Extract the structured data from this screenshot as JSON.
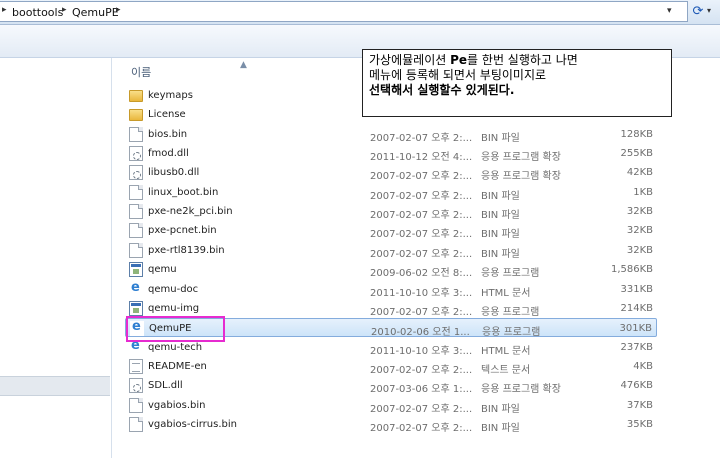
{
  "address_bar": {
    "breadcrumbs": [
      "boottools",
      "QemuPE"
    ]
  },
  "columns": {
    "name": "이름"
  },
  "files": [
    {
      "name": "keymaps",
      "date": "",
      "type": "",
      "size": "",
      "icon": "folder-icon"
    },
    {
      "name": "License",
      "date": "",
      "type": "",
      "size": "",
      "icon": "folder-icon"
    },
    {
      "name": "bios.bin",
      "date": "2007-02-07 오후 2:...",
      "type": "BIN 파일",
      "size": "128KB",
      "icon": "file-icon"
    },
    {
      "name": "fmod.dll",
      "date": "2011-10-12 오전 4:...",
      "type": "응용 프로그램 확장",
      "size": "255KB",
      "icon": "dll-icon"
    },
    {
      "name": "libusb0.dll",
      "date": "2007-02-07 오후 2:...",
      "type": "응용 프로그램 확장",
      "size": "42KB",
      "icon": "dll-icon"
    },
    {
      "name": "linux_boot.bin",
      "date": "2007-02-07 오후 2:...",
      "type": "BIN 파일",
      "size": "1KB",
      "icon": "file-icon"
    },
    {
      "name": "pxe-ne2k_pci.bin",
      "date": "2007-02-07 오후 2:...",
      "type": "BIN 파일",
      "size": "32KB",
      "icon": "file-icon"
    },
    {
      "name": "pxe-pcnet.bin",
      "date": "2007-02-07 오후 2:...",
      "type": "BIN 파일",
      "size": "32KB",
      "icon": "file-icon"
    },
    {
      "name": "pxe-rtl8139.bin",
      "date": "2007-02-07 오후 2:...",
      "type": "BIN 파일",
      "size": "32KB",
      "icon": "file-icon"
    },
    {
      "name": "qemu",
      "date": "2009-06-02 오전 8:...",
      "type": "응용 프로그램",
      "size": "1,586KB",
      "icon": "exe-icon"
    },
    {
      "name": "qemu-doc",
      "date": "2011-10-10 오후 3:...",
      "type": "HTML 문서",
      "size": "331KB",
      "icon": "html-icon"
    },
    {
      "name": "qemu-img",
      "date": "2007-02-07 오후 2:...",
      "type": "응용 프로그램",
      "size": "214KB",
      "icon": "exe-icon"
    },
    {
      "name": "QemuPE",
      "date": "2010-02-06 오전 1...",
      "type": "응용 프로그램",
      "size": "301KB",
      "icon": "html-icon",
      "selected": true
    },
    {
      "name": "qemu-tech",
      "date": "2011-10-10 오후 3:...",
      "type": "HTML 문서",
      "size": "237KB",
      "icon": "html-icon"
    },
    {
      "name": "README-en",
      "date": "2007-02-07 오후 2:...",
      "type": "텍스트 문서",
      "size": "4KB",
      "icon": "txt-icon"
    },
    {
      "name": "SDL.dll",
      "date": "2007-03-06 오후 1:...",
      "type": "응용 프로그램 확장",
      "size": "476KB",
      "icon": "dll-icon"
    },
    {
      "name": "vgabios.bin",
      "date": "2007-02-07 오후 2:...",
      "type": "BIN 파일",
      "size": "37KB",
      "icon": "file-icon"
    },
    {
      "name": "vgabios-cirrus.bin",
      "date": "2007-02-07 오후 2:...",
      "type": "BIN 파일",
      "size": "35KB",
      "icon": "file-icon"
    }
  ],
  "annotation": {
    "line1_prefix": "가상에뮬레이션 ",
    "line1_bold": "Pe",
    "line1_suffix": "를 한번 실행하고 나면",
    "line2": "메뉴에 등록해 되면서 부팅이미지로",
    "line3": "선택해서 실행할수 있게된다."
  },
  "colors": {
    "highlight": "#e62bd0",
    "selection": "#cde4f9"
  }
}
